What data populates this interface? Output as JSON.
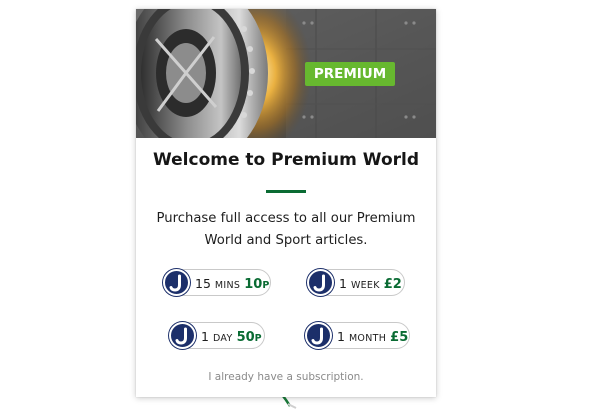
{
  "card": {
    "badge": "PREMIUM",
    "title": "Welcome to Premium World",
    "description": "Purchase full access to all our Premium World and Sport articles.",
    "options": [
      {
        "amount": "15",
        "unit": "MINS",
        "price": "10",
        "price_suffix": "P"
      },
      {
        "amount": "1",
        "unit": "WEEK",
        "price": "£2",
        "price_suffix": ""
      },
      {
        "amount": "1",
        "unit": "DAY",
        "price": "50",
        "price_suffix": "P"
      },
      {
        "amount": "1",
        "unit": "MONTH",
        "price": "£5",
        "price_suffix": ""
      }
    ],
    "subscription_link": "I already have a subscription."
  },
  "colors": {
    "badge": "#67b82f",
    "accent_green": "#0a6b33",
    "icon_navy": "#1c2f6a"
  },
  "icons": {
    "option_icon": "j-logo-icon",
    "hero_image": "vault-door-image"
  }
}
